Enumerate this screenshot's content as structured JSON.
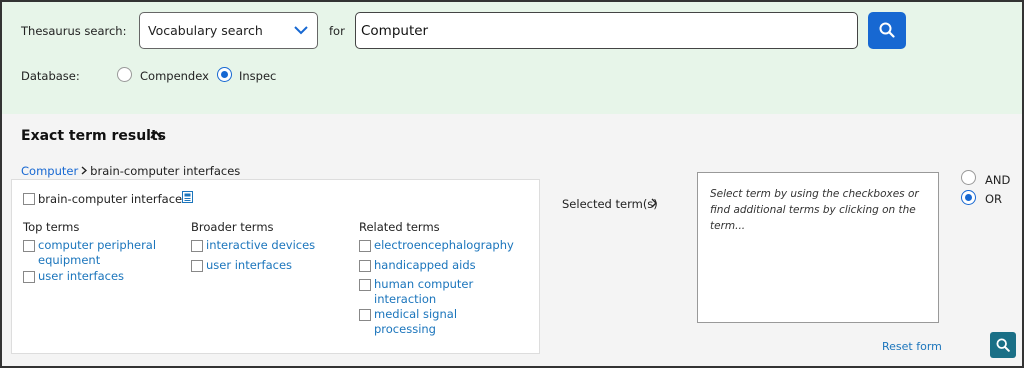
{
  "search": {
    "thesaurus_label": "Thesaurus search:",
    "vocab_selected": "Vocabulary search",
    "for_label": "for",
    "query": "Computer",
    "database_label": "Database:",
    "databases": [
      {
        "label": "Compendex",
        "selected": false
      },
      {
        "label": "Inspec",
        "selected": true
      }
    ],
    "search_icon": "search-icon"
  },
  "results": {
    "title": "Exact term results",
    "breadcrumb": {
      "root": "Computer",
      "current": "brain-computer interfaces"
    },
    "main_term": "brain-computer interfaces",
    "columns": {
      "top": {
        "heading": "Top terms",
        "terms": [
          "computer peripheral equipment",
          "user interfaces"
        ]
      },
      "broader": {
        "heading": "Broader terms",
        "terms": [
          "interactive devices",
          "user interfaces"
        ]
      },
      "related": {
        "heading": "Related terms",
        "terms": [
          "electroencephalography",
          "handicapped aids",
          "human computer interaction",
          "medical signal processing"
        ]
      }
    }
  },
  "selection": {
    "label": "Selected term(s)",
    "hint": "Select term by using the checkboxes or find additional terms by clicking on the term...",
    "operators": [
      {
        "label": "AND",
        "selected": false
      },
      {
        "label": "OR",
        "selected": true
      }
    ],
    "reset_label": "Reset form"
  },
  "colors": {
    "search_band": "#e7f5e9",
    "primary_blue": "#1768d2",
    "link_blue": "#1b75bc",
    "bottom_search": "#1a6f86"
  }
}
